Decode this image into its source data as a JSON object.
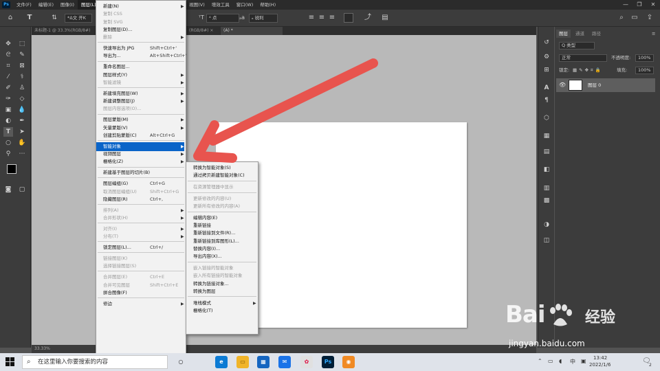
{
  "app": {
    "logo": "Ps",
    "menus": [
      "文件(F)",
      "编辑(E)",
      "图像(I)",
      "图层(L)",
      "文字(Y)",
      "选择(S)",
      "滤镜(T)",
      "3D(D)",
      "视图(V)",
      "增效工具",
      "窗口(W)",
      "帮助(H)"
    ],
    "active_menu_index": 3,
    "window_controls": [
      "—",
      "❐",
      "✕"
    ]
  },
  "options_bar": {
    "font_family": "*Δ文 开K",
    "font_size": "ᴬ 点",
    "antialias": "ₐ 锐利",
    "align_icons": [
      "left",
      "center",
      "right"
    ]
  },
  "doc_tabs": [
    {
      "label": "未标题-1 @ 33.3%(RGB/8#)",
      "active": false
    },
    {
      "label": "(RGB/8#) ×",
      "active": false
    },
    {
      "label": "(A) *",
      "active": true
    }
  ],
  "status_bar": "33.33%",
  "layers_panel": {
    "tabs": [
      "图层",
      "通道",
      "路径"
    ],
    "kind": "Q 类型",
    "blend_mode": "正常",
    "opacity_label": "不透明度:",
    "opacity_value": "100%",
    "lock_label": "锁定:",
    "fill_label": "填充:",
    "fill_value": "100%",
    "layer_name": "图层 0"
  },
  "layer_menu": {
    "items": [
      {
        "label": "新建(N)",
        "arrow": true
      },
      {
        "label": "复制 CSS",
        "dis": true
      },
      {
        "label": "复制 SVG",
        "dis": true
      },
      {
        "label": "复制图层(D)...",
        "dis": false
      },
      {
        "label": "删除",
        "arrow": true,
        "dis": true
      },
      {
        "sep": true
      },
      {
        "label": "快速导出为 JPG",
        "shortcut": "Shift+Ctrl+'"
      },
      {
        "label": "导出为...",
        "shortcut": "Alt+Shift+Ctrl+'"
      },
      {
        "sep": true
      },
      {
        "label": "重命名图层..."
      },
      {
        "label": "图层样式(Y)",
        "arrow": true
      },
      {
        "label": "智能滤镜",
        "arrow": true,
        "dis": true
      },
      {
        "sep": true
      },
      {
        "label": "新建填充图层(W)",
        "arrow": true
      },
      {
        "label": "新建调整图层(J)",
        "arrow": true
      },
      {
        "label": "图层内容选项(O)...",
        "dis": true
      },
      {
        "sep": true
      },
      {
        "label": "图层蒙版(M)",
        "arrow": true
      },
      {
        "label": "矢量蒙版(V)",
        "arrow": true
      },
      {
        "label": "创建剪贴蒙版(C)",
        "shortcut": "Alt+Ctrl+G"
      },
      {
        "sep": true
      },
      {
        "label": "智能对象",
        "arrow": true,
        "hl": true
      },
      {
        "label": "视频图层",
        "arrow": true
      },
      {
        "label": "栅格化(Z)",
        "arrow": true
      },
      {
        "sep": true
      },
      {
        "label": "新建基于图层的切片(B)"
      },
      {
        "sep": true
      },
      {
        "label": "图层编组(G)",
        "shortcut": "Ctrl+G"
      },
      {
        "label": "取消图层编组(U)",
        "shortcut": "Shift+Ctrl+G",
        "dis": true
      },
      {
        "label": "隐藏图层(R)",
        "shortcut": "Ctrl+,"
      },
      {
        "sep": true
      },
      {
        "label": "排列(A)",
        "arrow": true,
        "dis": true
      },
      {
        "label": "合并形状(H)",
        "arrow": true,
        "dis": true
      },
      {
        "sep": true
      },
      {
        "label": "对齐(I)",
        "arrow": true,
        "dis": true
      },
      {
        "label": "分布(T)",
        "arrow": true,
        "dis": true
      },
      {
        "sep": true
      },
      {
        "label": "锁定图层(L)...",
        "shortcut": "Ctrl+/"
      },
      {
        "sep": true
      },
      {
        "label": "链接图层(K)",
        "dis": true
      },
      {
        "label": "选择链接图层(S)",
        "dis": true
      },
      {
        "sep": true
      },
      {
        "label": "合并图层(E)",
        "shortcut": "Ctrl+E",
        "dis": true
      },
      {
        "label": "合并可见图层",
        "shortcut": "Shift+Ctrl+E",
        "dis": true
      },
      {
        "label": "拼合图像(F)"
      },
      {
        "sep": true
      },
      {
        "label": "修边",
        "arrow": true
      }
    ]
  },
  "smart_object_menu": {
    "items": [
      {
        "label": "转换为智能对象(S)"
      },
      {
        "label": "通过拷贝新建智能对象(C)"
      },
      {
        "sep": true
      },
      {
        "label": "在资源管理器中显示",
        "dis": true
      },
      {
        "sep": true
      },
      {
        "label": "更新修改的内容(U)",
        "dis": true
      },
      {
        "label": "更新所有修改的内容(A)",
        "dis": true
      },
      {
        "sep": true
      },
      {
        "label": "编辑内容(E)"
      },
      {
        "label": "重新链接"
      },
      {
        "label": "重新链接到文件(R)..."
      },
      {
        "label": "重新链接到库图形(L)..."
      },
      {
        "label": "替换内容(I)..."
      },
      {
        "label": "导出内容(X)..."
      },
      {
        "sep": true
      },
      {
        "label": "嵌入链接的智能对象",
        "dis": true
      },
      {
        "label": "嵌入所有链接的智能对象",
        "dis": true
      },
      {
        "label": "转换为链接对象..."
      },
      {
        "label": "转换为图层"
      },
      {
        "sep": true
      },
      {
        "label": "堆栈模式",
        "arrow": true
      },
      {
        "label": "栅格化(T)"
      }
    ]
  },
  "annotation": {
    "arrow_color": "#e8544e"
  },
  "watermark": {
    "brand_left": "Bai",
    "brand_right": "经验",
    "url": "jingyan.baidu.com"
  },
  "taskbar": {
    "search_placeholder": "在这里输入你要搜索的内容",
    "apps": [
      {
        "name": "cortana-icon",
        "glyph": "○",
        "bg": "transparent",
        "fg": "#222"
      },
      {
        "name": "edge-icon",
        "glyph": "e",
        "bg": "#0c7bd4",
        "fg": "#fff"
      },
      {
        "name": "explorer-icon",
        "glyph": "▭",
        "bg": "#f0b429",
        "fg": "#7a4f00"
      },
      {
        "name": "store-icon",
        "glyph": "▦",
        "bg": "#1565c0",
        "fg": "#fff"
      },
      {
        "name": "mail-icon",
        "glyph": "✉",
        "bg": "#1a73e8",
        "fg": "#fff"
      },
      {
        "name": "paint-icon",
        "glyph": "✿",
        "bg": "#e0e0e0",
        "fg": "#d14"
      },
      {
        "name": "photoshop-icon",
        "glyph": "Ps",
        "bg": "#001e36",
        "fg": "#31a8ff"
      },
      {
        "name": "app-orange-icon",
        "glyph": "◉",
        "bg": "#f08a24",
        "fg": "#fff"
      }
    ],
    "time": "13:42",
    "date": "2022/1/6",
    "notif_count": "2"
  }
}
